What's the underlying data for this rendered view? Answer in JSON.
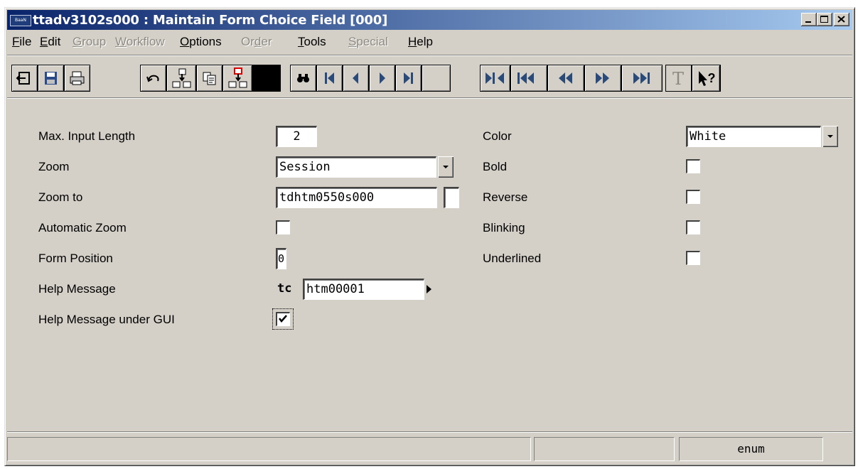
{
  "window": {
    "title": "ttadv3102s000 : Maintain Form Choice Field [000]",
    "app_icon_text": "BaaN"
  },
  "menu": [
    {
      "label": "File",
      "enabled": true
    },
    {
      "label": "Edit",
      "enabled": true
    },
    {
      "label": "Group",
      "enabled": false
    },
    {
      "label": "Workflow",
      "enabled": false
    },
    {
      "label": "Options",
      "enabled": true
    },
    {
      "label": "Order",
      "enabled": false
    },
    {
      "label": "Tools",
      "enabled": true
    },
    {
      "label": "Special",
      "enabled": false
    },
    {
      "label": "Help",
      "enabled": true
    }
  ],
  "toolbar": {
    "buttons": [
      "exit-icon",
      "save-icon",
      "print-icon",
      "undo-icon",
      "insert-record-icon",
      "copy-icon",
      "duplicate-record-icon",
      "find-icon",
      "first-record-icon",
      "previous-record-icon",
      "next-record-icon",
      "last-record-icon",
      "first-set-icon",
      "first-page-icon",
      "previous-page-icon",
      "next-page-icon",
      "last-page-icon",
      "text-icon",
      "context-help-icon"
    ]
  },
  "form": {
    "max_input_length": {
      "label": "Max. Input Length",
      "value": "2"
    },
    "zoom": {
      "label": "Zoom",
      "value": "Session"
    },
    "zoom_to": {
      "label": "Zoom to",
      "value": "tdhtm0550s000",
      "extra": ""
    },
    "automatic_zoom": {
      "label": "Automatic Zoom",
      "checked": false
    },
    "form_position": {
      "label": "Form Position",
      "value": "0"
    },
    "help_message": {
      "label": "Help Message",
      "prefix": "tc",
      "value": "htm00001"
    },
    "help_message_gui": {
      "label": "Help Message under GUI",
      "checked": true
    },
    "color": {
      "label": "Color",
      "value": "White"
    },
    "bold": {
      "label": "Bold",
      "checked": false
    },
    "reverse": {
      "label": "Reverse",
      "checked": false
    },
    "blinking": {
      "label": "Blinking",
      "checked": false
    },
    "underlined": {
      "label": "Underlined",
      "checked": false
    }
  },
  "status": {
    "panel1": "",
    "panel2": "",
    "panel3": "enum"
  }
}
